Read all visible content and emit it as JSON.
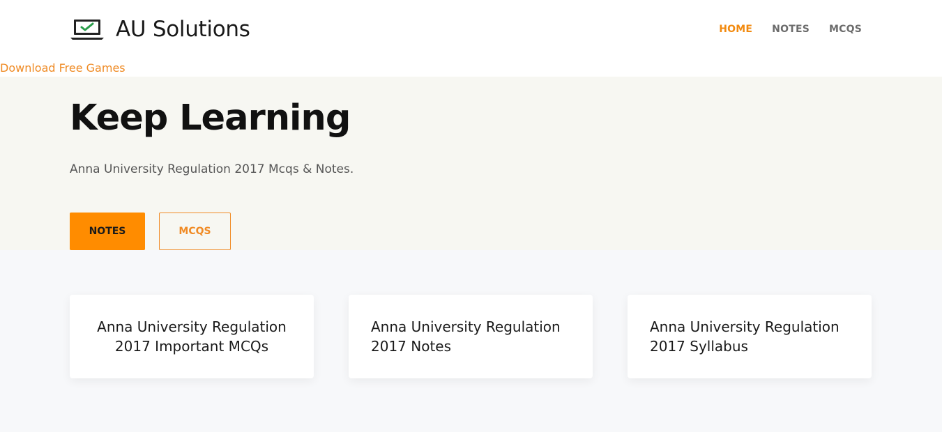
{
  "header": {
    "site_title": "AU Solutions",
    "logo_icon": "laptop-check-icon",
    "nav": [
      {
        "label": "HOME",
        "active": true
      },
      {
        "label": "NOTES",
        "active": false
      },
      {
        "label": "MCQS",
        "active": false
      }
    ],
    "promo_link": "Download Free Games"
  },
  "hero": {
    "title": "Keep Learning",
    "subtitle": "Anna University Regulation 2017 Mcqs & Notes.",
    "primary_button": "NOTES",
    "secondary_button": "MCQS"
  },
  "cards": [
    {
      "title": "Anna University Regulation 2017 Important MCQs"
    },
    {
      "title": "Anna University Regulation 2017 Notes"
    },
    {
      "title": "Anna University Regulation 2017 Syllabus"
    }
  ],
  "colors": {
    "accent": "#ff8c00",
    "link": "#ef8a23",
    "hero_bg": "#f7f7f2",
    "page_bg": "#f7f8fa"
  }
}
